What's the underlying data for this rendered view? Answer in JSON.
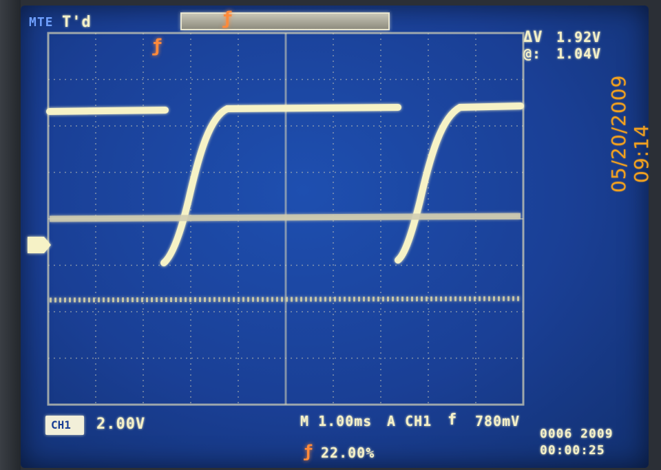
{
  "top_left": {
    "mode": "MTE",
    "run_state": "T'd"
  },
  "cursors": {
    "delta_label": "ΔV",
    "delta_value": "1.92V",
    "at_label": "@:",
    "at_value": "1.04V"
  },
  "channel_1": {
    "label": "CH1",
    "volts_per_div": "2.00V"
  },
  "timebase": {
    "label": "M 1.00ms",
    "trigger_source": "A CH1",
    "trigger_slope": "f",
    "trigger_level": "780mV"
  },
  "trigger_pos": {
    "value": "22.00%"
  },
  "datetime": {
    "date": "05/20/2009",
    "time": "09:14"
  },
  "status_counter": {
    "line1": "0006 2009",
    "line2": "00:00:25"
  },
  "colors": {
    "trace": "#f6f2c6",
    "grid": "#d9d6b8",
    "screen": "#1a3f95",
    "accent": "#ff8a3a",
    "stamp": "#f0a020"
  },
  "icons": {
    "ground_marker": "channel-ground-arrow-icon",
    "trigger_marker": "trigger-position-icon"
  }
}
